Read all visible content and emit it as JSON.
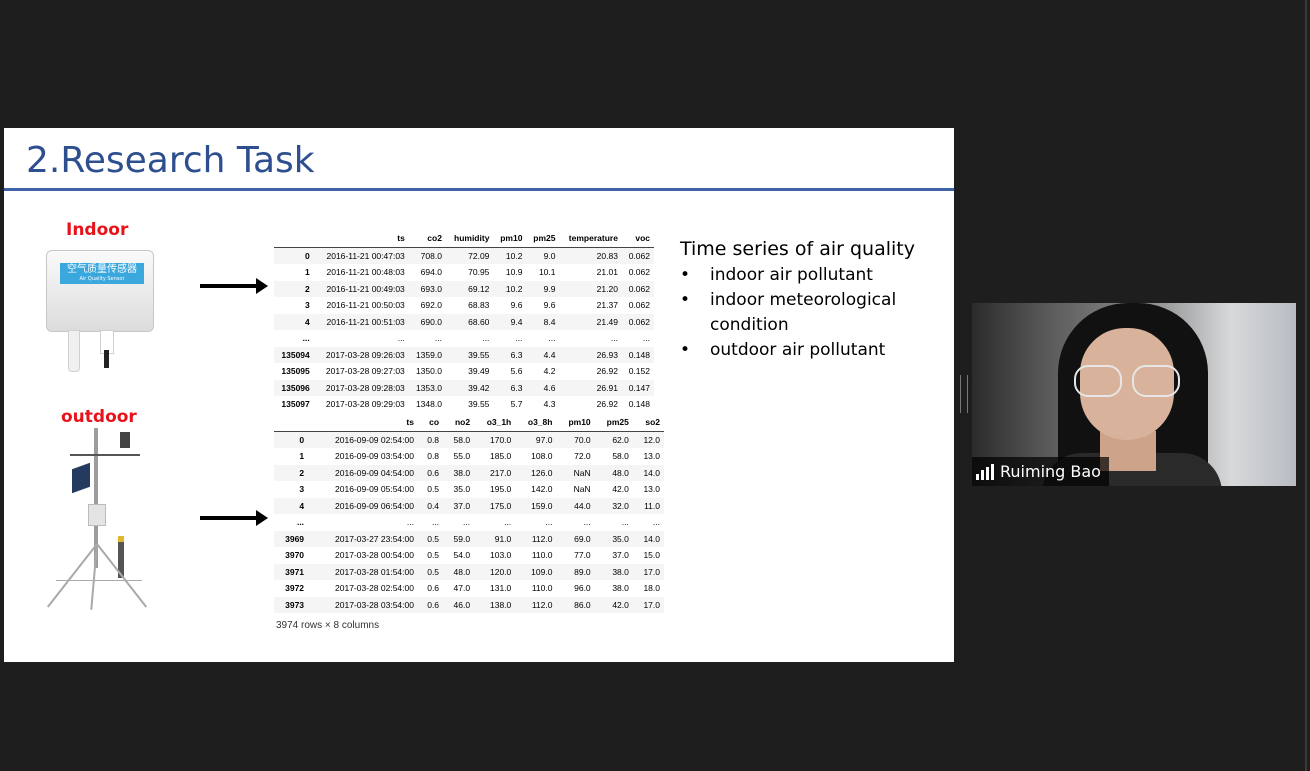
{
  "slide": {
    "title": "2.Research Task",
    "indoor_label": "Indoor",
    "outdoor_label": "outdoor",
    "sensor_text": "空气质量传感器",
    "sensor_subtext": "Air Quality Sensor",
    "indoor_table": {
      "columns": [
        "",
        "ts",
        "co2",
        "humidity",
        "pm10",
        "pm25",
        "temperature",
        "voc"
      ],
      "rows": [
        [
          "0",
          "2016-11-21 00:47:03",
          "708.0",
          "72.09",
          "10.2",
          "9.0",
          "20.83",
          "0.062"
        ],
        [
          "1",
          "2016-11-21 00:48:03",
          "694.0",
          "70.95",
          "10.9",
          "10.1",
          "21.01",
          "0.062"
        ],
        [
          "2",
          "2016-11-21 00:49:03",
          "693.0",
          "69.12",
          "10.2",
          "9.9",
          "21.20",
          "0.062"
        ],
        [
          "3",
          "2016-11-21 00:50:03",
          "692.0",
          "68.83",
          "9.6",
          "9.6",
          "21.37",
          "0.062"
        ],
        [
          "4",
          "2016-11-21 00:51:03",
          "690.0",
          "68.60",
          "9.4",
          "8.4",
          "21.49",
          "0.062"
        ],
        [
          "...",
          "...",
          "...",
          "...",
          "...",
          "...",
          "...",
          "..."
        ],
        [
          "135094",
          "2017-03-28 09:26:03",
          "1359.0",
          "39.55",
          "6.3",
          "4.4",
          "26.93",
          "0.148"
        ],
        [
          "135095",
          "2017-03-28 09:27:03",
          "1350.0",
          "39.49",
          "5.6",
          "4.2",
          "26.92",
          "0.152"
        ],
        [
          "135096",
          "2017-03-28 09:28:03",
          "1353.0",
          "39.42",
          "6.3",
          "4.6",
          "26.91",
          "0.147"
        ],
        [
          "135097",
          "2017-03-28 09:29:03",
          "1348.0",
          "39.55",
          "5.7",
          "4.3",
          "26.92",
          "0.148"
        ]
      ]
    },
    "outdoor_table": {
      "columns": [
        "",
        "ts",
        "co",
        "no2",
        "o3_1h",
        "o3_8h",
        "pm10",
        "pm25",
        "so2"
      ],
      "rows": [
        [
          "0",
          "2016-09-09 02:54:00",
          "0.8",
          "58.0",
          "170.0",
          "97.0",
          "70.0",
          "62.0",
          "12.0"
        ],
        [
          "1",
          "2016-09-09 03:54:00",
          "0.8",
          "55.0",
          "185.0",
          "108.0",
          "72.0",
          "58.0",
          "13.0"
        ],
        [
          "2",
          "2016-09-09 04:54:00",
          "0.6",
          "38.0",
          "217.0",
          "126.0",
          "NaN",
          "48.0",
          "14.0"
        ],
        [
          "3",
          "2016-09-09 05:54:00",
          "0.5",
          "35.0",
          "195.0",
          "142.0",
          "NaN",
          "42.0",
          "13.0"
        ],
        [
          "4",
          "2016-09-09 06:54:00",
          "0.4",
          "37.0",
          "175.0",
          "159.0",
          "44.0",
          "32.0",
          "11.0"
        ],
        [
          "...",
          "...",
          "...",
          "...",
          "...",
          "...",
          "...",
          "...",
          "..."
        ],
        [
          "3969",
          "2017-03-27 23:54:00",
          "0.5",
          "59.0",
          "91.0",
          "112.0",
          "69.0",
          "35.0",
          "14.0"
        ],
        [
          "3970",
          "2017-03-28 00:54:00",
          "0.5",
          "54.0",
          "103.0",
          "110.0",
          "77.0",
          "37.0",
          "15.0"
        ],
        [
          "3971",
          "2017-03-28 01:54:00",
          "0.5",
          "48.0",
          "120.0",
          "109.0",
          "89.0",
          "38.0",
          "17.0"
        ],
        [
          "3972",
          "2017-03-28 02:54:00",
          "0.6",
          "47.0",
          "131.0",
          "110.0",
          "96.0",
          "38.0",
          "18.0"
        ],
        [
          "3973",
          "2017-03-28 03:54:00",
          "0.6",
          "46.0",
          "138.0",
          "112.0",
          "86.0",
          "42.0",
          "17.0"
        ]
      ],
      "footer": "3974 rows × 8 columns"
    },
    "bullets": {
      "heading": "Time series of air quality",
      "items": [
        "indoor air pollutant",
        "indoor meteorological condition",
        "outdoor air pollutant"
      ]
    }
  },
  "video": {
    "participant_name": "Ruiming Bao",
    "signal_icon": "signal-bars-icon"
  }
}
